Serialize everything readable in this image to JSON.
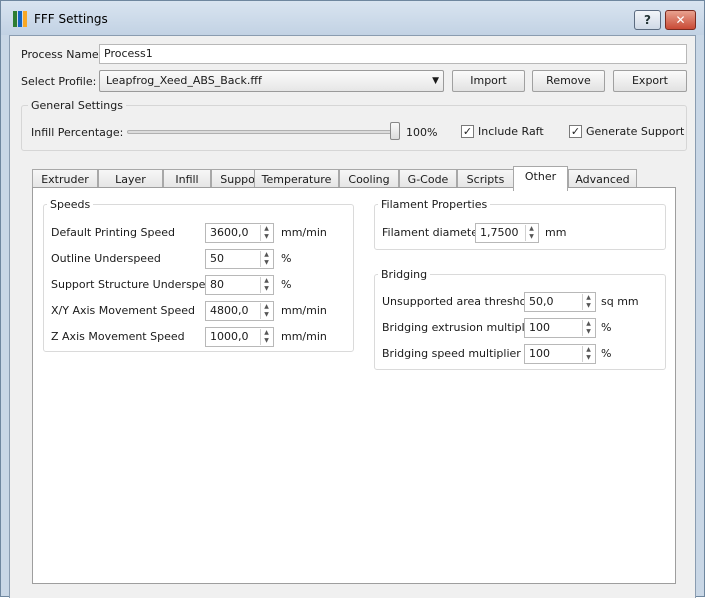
{
  "window": {
    "title": "FFF Settings",
    "help": "?",
    "close": "✕"
  },
  "process": {
    "label": "Process Name:",
    "value": "Process1"
  },
  "profile": {
    "label": "Select Profile:",
    "value": "Leapfrog_Xeed_ABS_Back.fff",
    "import": "Import",
    "remove": "Remove",
    "export": "Export"
  },
  "general": {
    "title": "General Settings",
    "infill_label": "Infill Percentage:",
    "infill_value": "100%",
    "infill_fraction": 1.0,
    "include_raft": "Include Raft",
    "generate_support": "Generate Support",
    "include_raft_checked": true,
    "generate_support_checked": true
  },
  "tabs": [
    "Extruder",
    "Layer",
    "Infill",
    "Support",
    "Temperature",
    "Cooling",
    "G-Code",
    "Scripts",
    "Other",
    "Advanced"
  ],
  "active_tab": "Other",
  "speeds": {
    "title": "Speeds",
    "rows": [
      {
        "label": "Default Printing Speed",
        "value": "3600,0",
        "unit": "mm/min"
      },
      {
        "label": "Outline Underspeed",
        "value": "50",
        "unit": "%"
      },
      {
        "label": "Support Structure Underspeed",
        "value": "80",
        "unit": "%"
      },
      {
        "label": "X/Y Axis Movement Speed",
        "value": "4800,0",
        "unit": "mm/min"
      },
      {
        "label": "Z Axis Movement Speed",
        "value": "1000,0",
        "unit": "mm/min"
      }
    ]
  },
  "filament": {
    "title": "Filament Properties",
    "rows": [
      {
        "label": "Filament diameter",
        "value": "1,7500",
        "unit": "mm"
      }
    ]
  },
  "bridging": {
    "title": "Bridging",
    "rows": [
      {
        "label": "Unsupported area threshold",
        "value": "50,0",
        "unit": "sq mm"
      },
      {
        "label": "Bridging extrusion multiplier",
        "value": "100",
        "unit": "%"
      },
      {
        "label": "Bridging speed multiplier",
        "value": "100",
        "unit": "%"
      }
    ]
  },
  "icons": {
    "spin_up": "▲",
    "spin_down": "▼",
    "dropdown": "▼",
    "check": "✓"
  },
  "colors": {
    "titlebar": "#c9d7e6",
    "close": "#c94a36",
    "icon_bars": [
      "#2e7d32",
      "#1565c0",
      "#f9a825"
    ]
  }
}
